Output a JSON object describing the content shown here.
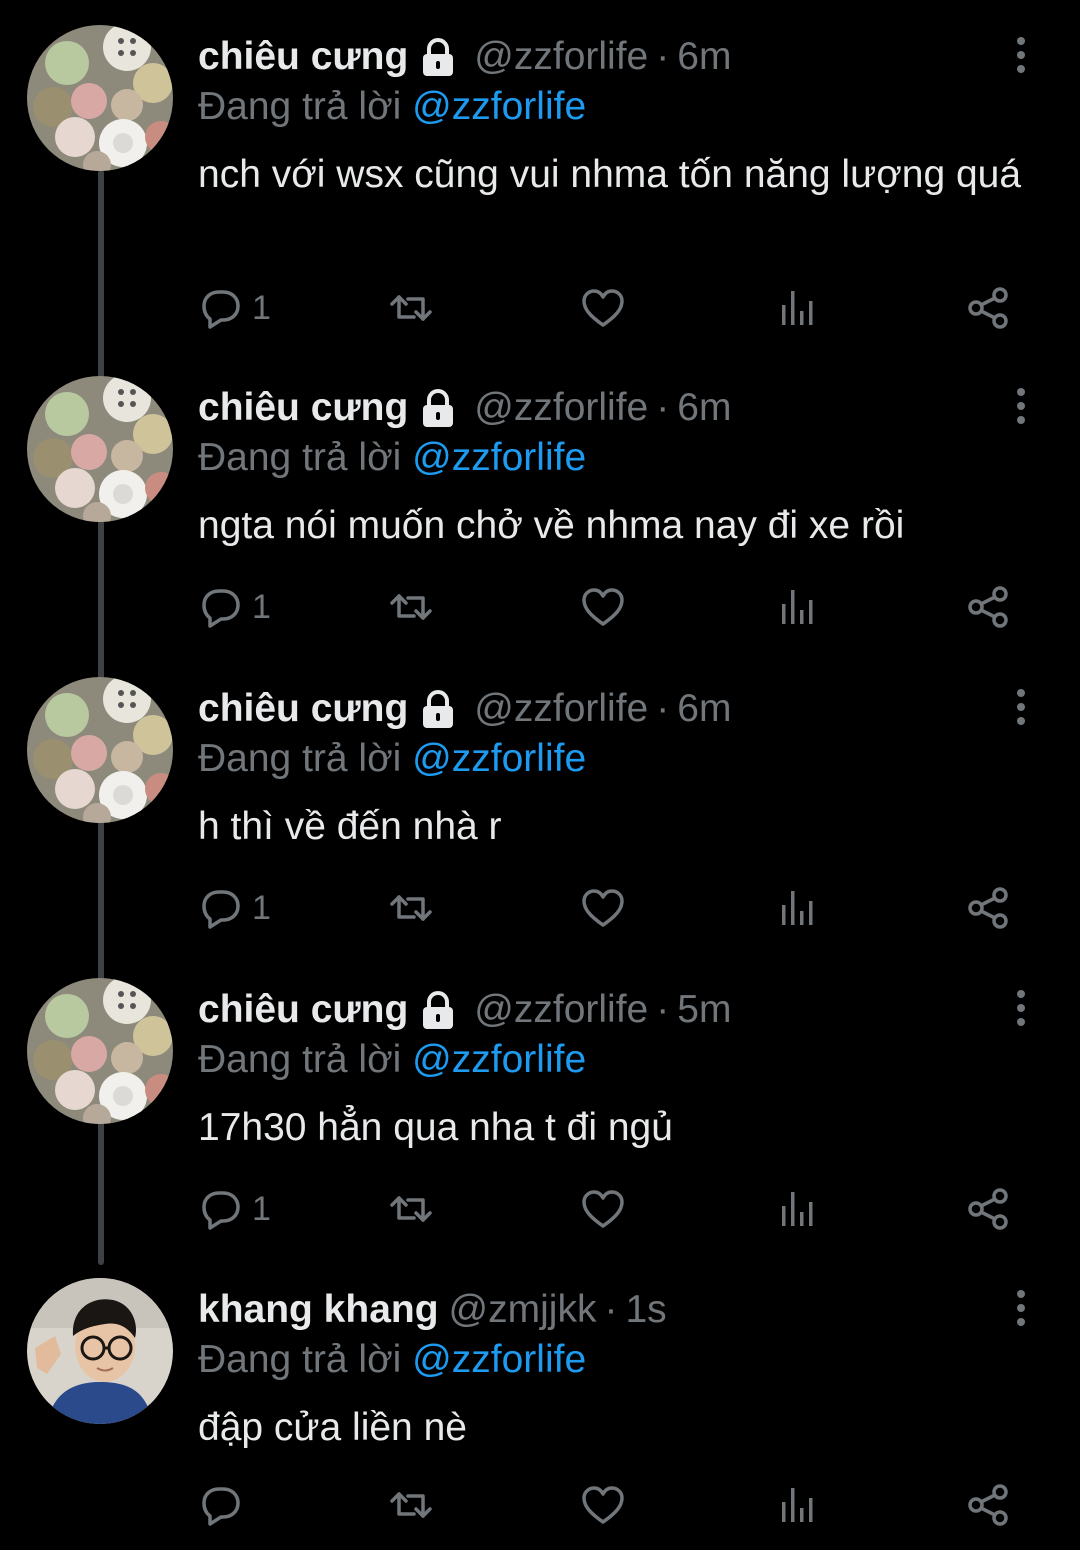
{
  "reply_prefix": "Đang trả lời",
  "tweets": [
    {
      "name": "chiêu cưng",
      "locked": true,
      "handle": "@zzforlife",
      "dot": "·",
      "time": "6m",
      "reply_to": "@zzforlife",
      "text": "nch với wsx cũng vui nhma tốn năng lượng quá",
      "reply_count": "1"
    },
    {
      "name": "chiêu cưng",
      "locked": true,
      "handle": "@zzforlife",
      "dot": "·",
      "time": "6m",
      "reply_to": "@zzforlife",
      "text": "ngta nói muốn chở về nhma nay đi xe rồi",
      "reply_count": "1"
    },
    {
      "name": "chiêu cưng",
      "locked": true,
      "handle": "@zzforlife",
      "dot": "·",
      "time": "6m",
      "reply_to": "@zzforlife",
      "text": "h thì về đến nhà r",
      "reply_count": "1"
    },
    {
      "name": "chiêu cưng",
      "locked": true,
      "handle": "@zzforlife",
      "dot": "·",
      "time": "5m",
      "reply_to": "@zzforlife",
      "text": "17h30 hẳn qua nha t đi ngủ",
      "reply_count": "1"
    },
    {
      "name": "khang khang",
      "locked": false,
      "handle": "@zmjjkk",
      "dot": "·",
      "time": "1s",
      "reply_to": "@zzforlife",
      "text": "đập cửa liền nè",
      "reply_count": ""
    }
  ],
  "icons": {
    "lock": "lock-icon",
    "more": "vertical-dots-icon",
    "reply": "speech-bubble-icon",
    "retweet": "retweet-icon",
    "like": "heart-icon",
    "views": "bar-chart-icon",
    "share": "share-icon"
  },
  "colors": {
    "background": "#000000",
    "text": "#e7e9ea",
    "muted": "#71767b",
    "accent": "#1d9bf0",
    "thread_line": "#3e4144"
  }
}
